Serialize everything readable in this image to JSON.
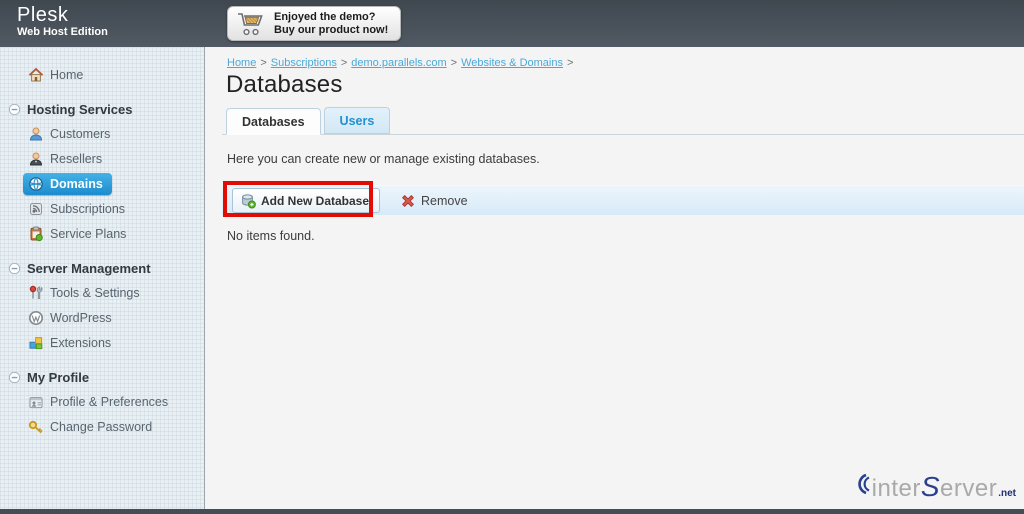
{
  "header": {
    "product": "Plesk",
    "edition": "Web Host Edition",
    "promo_line1": "Enjoyed the demo?",
    "promo_line2": "Buy our product now!"
  },
  "sidebar": {
    "home_label": "Home",
    "groups": [
      {
        "label": "Hosting Services",
        "items": [
          {
            "label": "Customers"
          },
          {
            "label": "Resellers"
          },
          {
            "label": "Domains",
            "selected": true
          },
          {
            "label": "Subscriptions"
          },
          {
            "label": "Service Plans"
          }
        ]
      },
      {
        "label": "Server Management",
        "items": [
          {
            "label": "Tools & Settings"
          },
          {
            "label": "WordPress"
          },
          {
            "label": "Extensions"
          }
        ]
      },
      {
        "label": "My Profile",
        "items": [
          {
            "label": "Profile & Preferences"
          },
          {
            "label": "Change Password"
          }
        ]
      }
    ]
  },
  "breadcrumb": {
    "items": [
      "Home",
      "Subscriptions",
      "demo.parallels.com",
      "Websites & Domains"
    ],
    "separator": ">"
  },
  "page": {
    "title": "Databases",
    "description": "Here you can create new or manage existing databases.",
    "empty_text": "No items found."
  },
  "tabs": [
    {
      "label": "Databases",
      "active": true
    },
    {
      "label": "Users",
      "active": false
    }
  ],
  "toolbar": {
    "add_button": "Add New Database",
    "remove_button": "Remove"
  },
  "watermark": {
    "part1": "inter",
    "part2": "Server",
    "suffix": ".net"
  },
  "colors": {
    "accent": "#2191cf",
    "selected_item": "#1b8ccd",
    "annotation": "#e10c04",
    "header_bg": "#454d57",
    "toolbar_bg": "#d7eaf8"
  }
}
